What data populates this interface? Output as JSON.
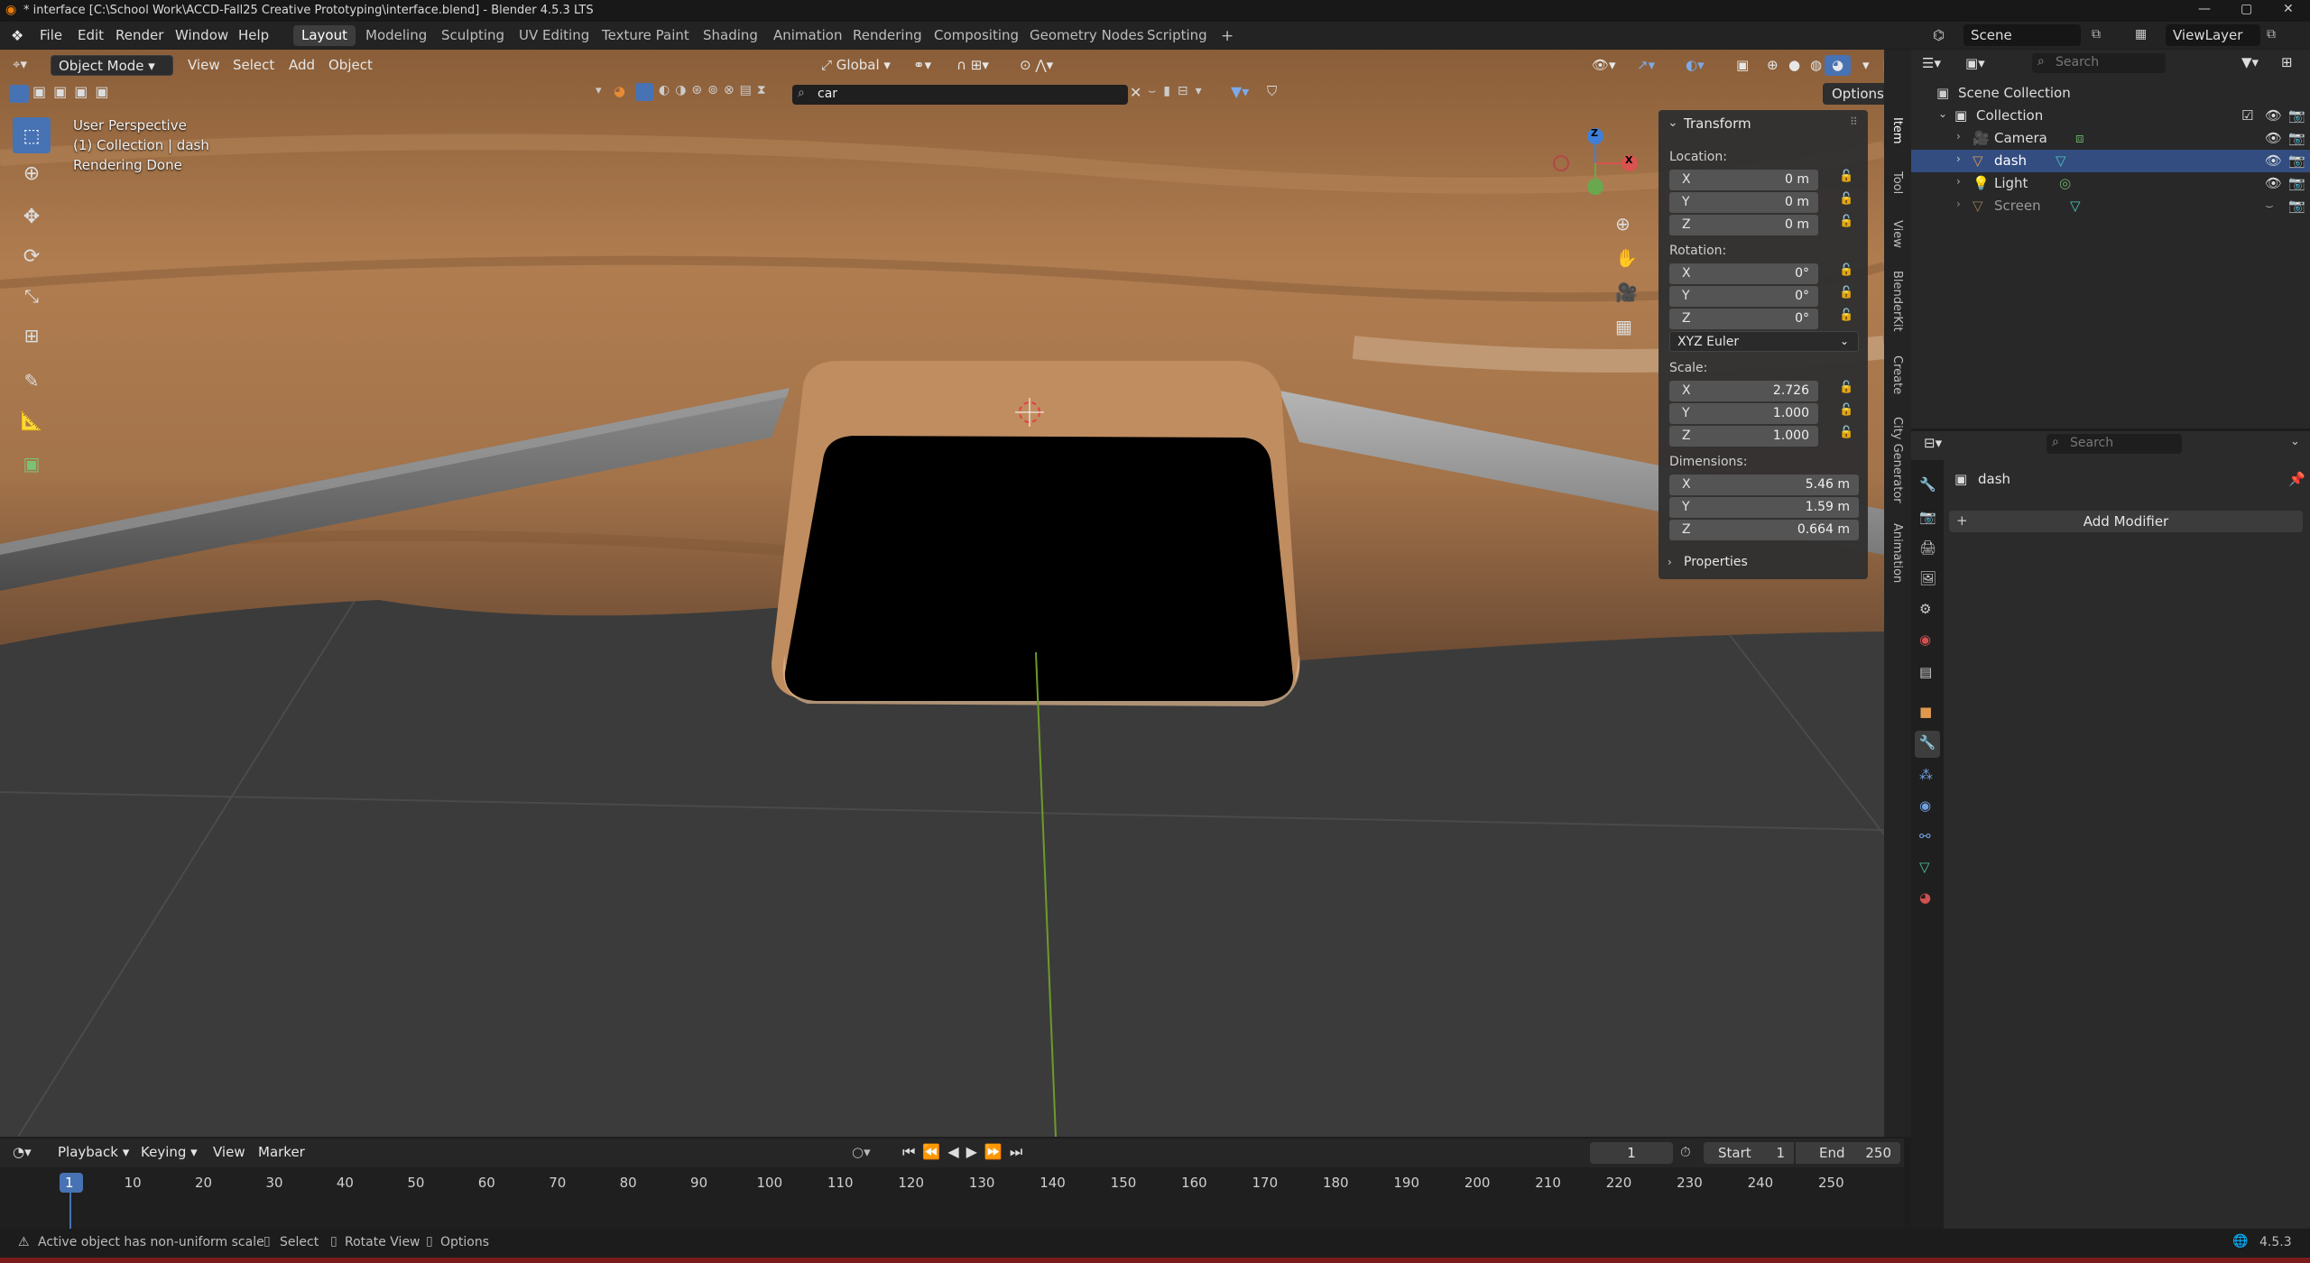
{
  "window": {
    "title": "* interface [C:\\School Work\\ACCD-Fall25 Creative Prototyping\\interface.blend] - Blender 4.5.3 LTS",
    "controls": [
      "—",
      "▢",
      "✕"
    ]
  },
  "menubar": {
    "menus": [
      "File",
      "Edit",
      "Render",
      "Window",
      "Help"
    ],
    "workspaces": [
      "Layout",
      "Modeling",
      "Sculpting",
      "UV Editing",
      "Texture Paint",
      "Shading",
      "Animation",
      "Rendering",
      "Compositing",
      "Geometry Nodes",
      "Scripting"
    ],
    "active_workspace": "Layout",
    "add_tab": "+",
    "scene": "Scene",
    "view_layer": "ViewLayer"
  },
  "viewport_header": {
    "mode": "Object Mode",
    "menus": [
      "View",
      "Select",
      "Add",
      "Object"
    ],
    "orientation": "Global",
    "search_value": "car",
    "options": "Options"
  },
  "viewport_overlay": {
    "line1": "User Perspective",
    "line2": "(1) Collection | dash",
    "line3": "Rendering Done"
  },
  "gizmo": {
    "z": "Z",
    "x": "X",
    "y": "Y"
  },
  "transform_panel": {
    "title": "Transform",
    "location_label": "Location:",
    "location": [
      {
        "axis": "X",
        "value": "0 m"
      },
      {
        "axis": "Y",
        "value": "0 m"
      },
      {
        "axis": "Z",
        "value": "0 m"
      }
    ],
    "rotation_label": "Rotation:",
    "rotation": [
      {
        "axis": "X",
        "value": "0°"
      },
      {
        "axis": "Y",
        "value": "0°"
      },
      {
        "axis": "Z",
        "value": "0°"
      }
    ],
    "rotation_mode": "XYZ Euler",
    "scale_label": "Scale:",
    "scale": [
      {
        "axis": "X",
        "value": "2.726"
      },
      {
        "axis": "Y",
        "value": "1.000"
      },
      {
        "axis": "Z",
        "value": "1.000"
      }
    ],
    "dimensions_label": "Dimensions:",
    "dimensions": [
      {
        "axis": "X",
        "value": "5.46 m"
      },
      {
        "axis": "Y",
        "value": "1.59 m"
      },
      {
        "axis": "Z",
        "value": "0.664 m"
      }
    ],
    "properties_label": "Properties"
  },
  "side_tabs": [
    "Item",
    "Tool",
    "View",
    "BlenderKit",
    "Create",
    "City Generator",
    "Animation"
  ],
  "outliner": {
    "search_placeholder": "Search",
    "scene_collection": "Scene Collection",
    "collection": "Collection",
    "items": [
      {
        "name": "Camera",
        "selected": false
      },
      {
        "name": "dash",
        "selected": true
      },
      {
        "name": "Light",
        "selected": false
      },
      {
        "name": "Screen",
        "selected": false
      }
    ]
  },
  "properties": {
    "search_placeholder": "Search",
    "object_name": "dash",
    "add_modifier": "Add Modifier"
  },
  "timeline": {
    "menus": [
      "Playback",
      "Keying",
      "View",
      "Marker"
    ],
    "current_frame": "1",
    "start_label": "Start",
    "start": "1",
    "end_label": "End",
    "end": "250",
    "ticks": [
      "1",
      "10",
      "20",
      "30",
      "40",
      "50",
      "60",
      "70",
      "80",
      "90",
      "100",
      "110",
      "120",
      "130",
      "140",
      "150",
      "160",
      "170",
      "180",
      "190",
      "200",
      "210",
      "220",
      "230",
      "240",
      "250"
    ]
  },
  "statusbar": {
    "warning": "Active object has non-uniform scale",
    "select": "Select",
    "rotate": "Rotate View",
    "options": "Options",
    "version": "4.5.3"
  },
  "colors": {
    "accent": "#4772b3",
    "selection_row": "#334d80",
    "wood": "#a5764c",
    "floor": "#3b3b3b"
  }
}
